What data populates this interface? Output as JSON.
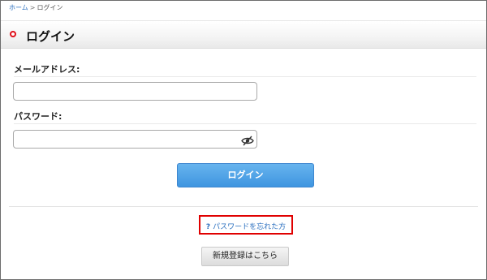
{
  "breadcrumb": {
    "home": "ホーム",
    "separator": ">",
    "current": "ログイン"
  },
  "header": {
    "title": "ログイン",
    "bullet_color": "#e0101a"
  },
  "form": {
    "email": {
      "label": "メールアドレス:",
      "value": "",
      "placeholder": ""
    },
    "password": {
      "label": "パスワード:",
      "value": "",
      "placeholder": "",
      "toggle_icon": "eye-slash-icon"
    },
    "submit_label": "ログイン"
  },
  "forgot": {
    "icon": "?",
    "label": "パスワードを忘れた方",
    "highlight_color": "#e00000"
  },
  "register": {
    "label": "新規登録はこちら"
  },
  "colors": {
    "link": "#2a6fbf",
    "primary_button": "#4b9fe6"
  }
}
